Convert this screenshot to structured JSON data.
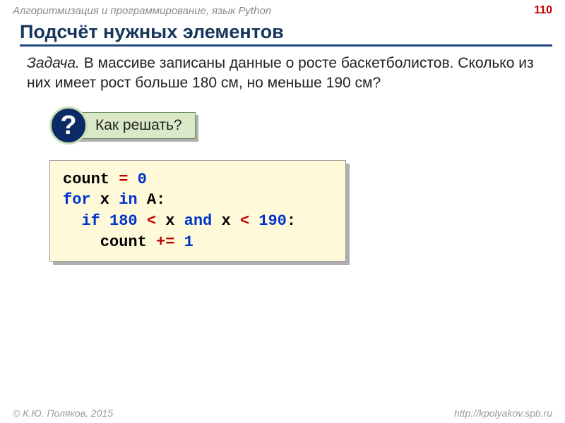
{
  "header": {
    "course": "Алгоритмизация и программирование, язык Python",
    "page": "110"
  },
  "title": "Подсчёт нужных элементов",
  "task": {
    "label": "Задача.",
    "text": "В массиве записаны данные о росте баскетболистов. Сколько из них имеет рост больше 180 см, но меньше 190 см?"
  },
  "callout": {
    "mark": "?",
    "text": "Как решать?"
  },
  "code": {
    "l1a": "count ",
    "l1b": "=",
    "l1c": " 0",
    "l2a": "for",
    "l2b": " x ",
    "l2c": "in",
    "l2d": " A:",
    "l3a": "  if",
    "l3b": " 180",
    "l3c": " <",
    "l3d": " x ",
    "l3e": "and",
    "l3f": " x ",
    "l3g": "<",
    "l3h": " 190",
    "l3i": ":",
    "l4a": "    count ",
    "l4b": "+=",
    "l4c": " 1"
  },
  "footer": {
    "left": "© К.Ю. Поляков, 2015",
    "right": "http://kpolyakov.spb.ru"
  }
}
